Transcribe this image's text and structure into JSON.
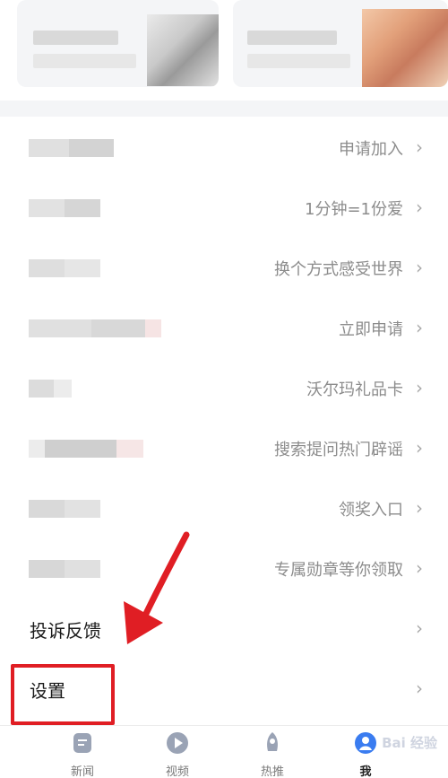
{
  "menu": {
    "rows": [
      {
        "right": "申请加入"
      },
      {
        "right": "1分钟=1份爱"
      },
      {
        "right": "换个方式感受世界"
      },
      {
        "right": "立即申请"
      },
      {
        "right": "沃尔玛礼品卡"
      },
      {
        "right": "搜索提问热门辟谣"
      },
      {
        "right": "领奖入口"
      },
      {
        "right": "专属勋章等你领取"
      }
    ],
    "feedback_label": "投诉反馈",
    "settings_label": "设置",
    "chevron": "›"
  },
  "bottom_nav": {
    "items": [
      {
        "label": "新闻",
        "icon": "news-icon"
      },
      {
        "label": "视频",
        "icon": "play-icon"
      },
      {
        "label": "热推",
        "icon": "rocket-icon"
      },
      {
        "label": "我",
        "icon": "profile-icon"
      }
    ],
    "active": "我"
  },
  "watermark": "Bai 经验",
  "colors": {
    "highlight_box": "#e01e24",
    "arrow": "#e01e24",
    "secondary_text": "#8c8c8c",
    "nav_icon": "#9aa3b5"
  }
}
